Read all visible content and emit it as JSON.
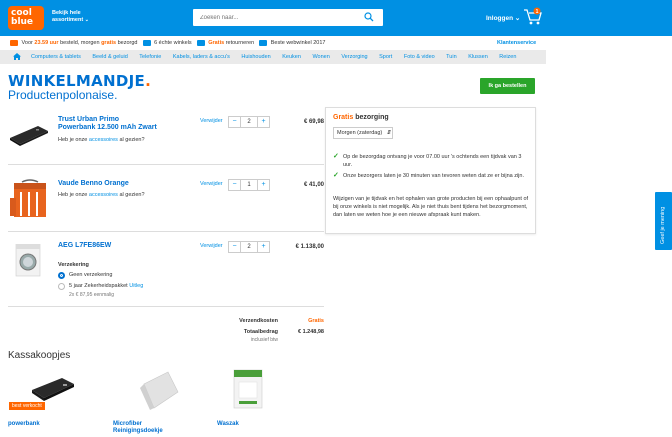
{
  "header": {
    "logo_line1": "cool",
    "logo_line2": "blue",
    "assortment_line1": "Bekijk hele",
    "assortment_line2": "assortiment",
    "search_placeholder": "Zoeken naar...",
    "login_label": "Inloggen",
    "cart_count": "1",
    "colors": {
      "header_bg": "#0090e3",
      "logo_bg": "#ff6600"
    }
  },
  "usp": {
    "part1": "Voor",
    "time": "23.59 uur",
    "part2": "besteld, morgen",
    "gratis1": "gratis",
    "part3": "bezorgd",
    "stores": "6 échte winkels",
    "gratis2": "Gratis",
    "returns": "retourneren",
    "award": "Beste webwinkel 2017",
    "service": "Klantenservice"
  },
  "nav": {
    "items": [
      "Computers & tablets",
      "Beeld & geluid",
      "Telefonie",
      "Kabels, laders & accu's",
      "Huishouden",
      "Keuken",
      "Wonen",
      "Verzorging",
      "Sport",
      "Foto & video",
      "Tuin",
      "Klussen",
      "Reizen"
    ]
  },
  "page": {
    "title": "WINKELMANDJE",
    "subtitle": "Productenpolonaise.",
    "order_button": "Ik ga bestellen"
  },
  "cart": {
    "remove_label": "Verwijder",
    "items": [
      {
        "name_line1": "Trust Urban Primo",
        "name_line2": "Powerbank 12.500 mAh Zwart",
        "sub_pre": "Heb je onze",
        "sub_link": "accessoires",
        "sub_post": "al gezien?",
        "qty": "2",
        "price": "€ 69,98",
        "image": "powerbank-image"
      },
      {
        "name_line1": "Vaude Benno Orange",
        "name_line2": "",
        "sub_pre": "Heb je onze",
        "sub_link": "accessoires",
        "sub_post": "al gezien?",
        "qty": "1",
        "price": "€ 41,00",
        "image": "toiletry-bag-image"
      },
      {
        "name_line1": "AEG L7FE86EW",
        "name_line2": "",
        "sub_pre": "",
        "sub_link": "",
        "sub_post": "",
        "qty": "2",
        "price": "€ 1.138,00",
        "image": "washing-machine-image"
      }
    ],
    "insurance": {
      "title": "Verzekering",
      "option1": "Geen verzekering",
      "option2": "5 jaar Zekerheidspakket",
      "option2_link": "Uitleg",
      "option2_sub": "2x € 87,95 eenmalig"
    },
    "totals": {
      "shipping_label": "Verzendkosten",
      "shipping_value": "Gratis",
      "total_label": "Totaalbedrag",
      "total_value": "€ 1.248,98",
      "incl": "inclusief btw"
    }
  },
  "delivery": {
    "title_gratis": "Gratis",
    "title_rest": "bezorging",
    "select_value": "Morgen (zaterdag)",
    "bullets": [
      "Op de bezorgdag ontvang je voor 07.00 uur 's ochtends een tijdvak van 3 uur.",
      "Onze bezorgers laten je 30 minuten van tevoren weten dat ze er bijna zijn."
    ],
    "note": "Wijzigen van je tijdvak en het ophalen van grote producten bij een ophaalpunt of bij onze winkels is niet mogelijk. Als je niet thuis bent tijdens het bezorgmoment, dan laten we weten hoe je een nieuwe afspraak kunt maken."
  },
  "feedback": {
    "label": "Geef je mening"
  },
  "kassa": {
    "title": "Kassakoopjes",
    "badge": "best verkocht",
    "items": [
      "powerbank",
      "Microfiber",
      "Reinigingsdoekje",
      "Waszak"
    ]
  }
}
